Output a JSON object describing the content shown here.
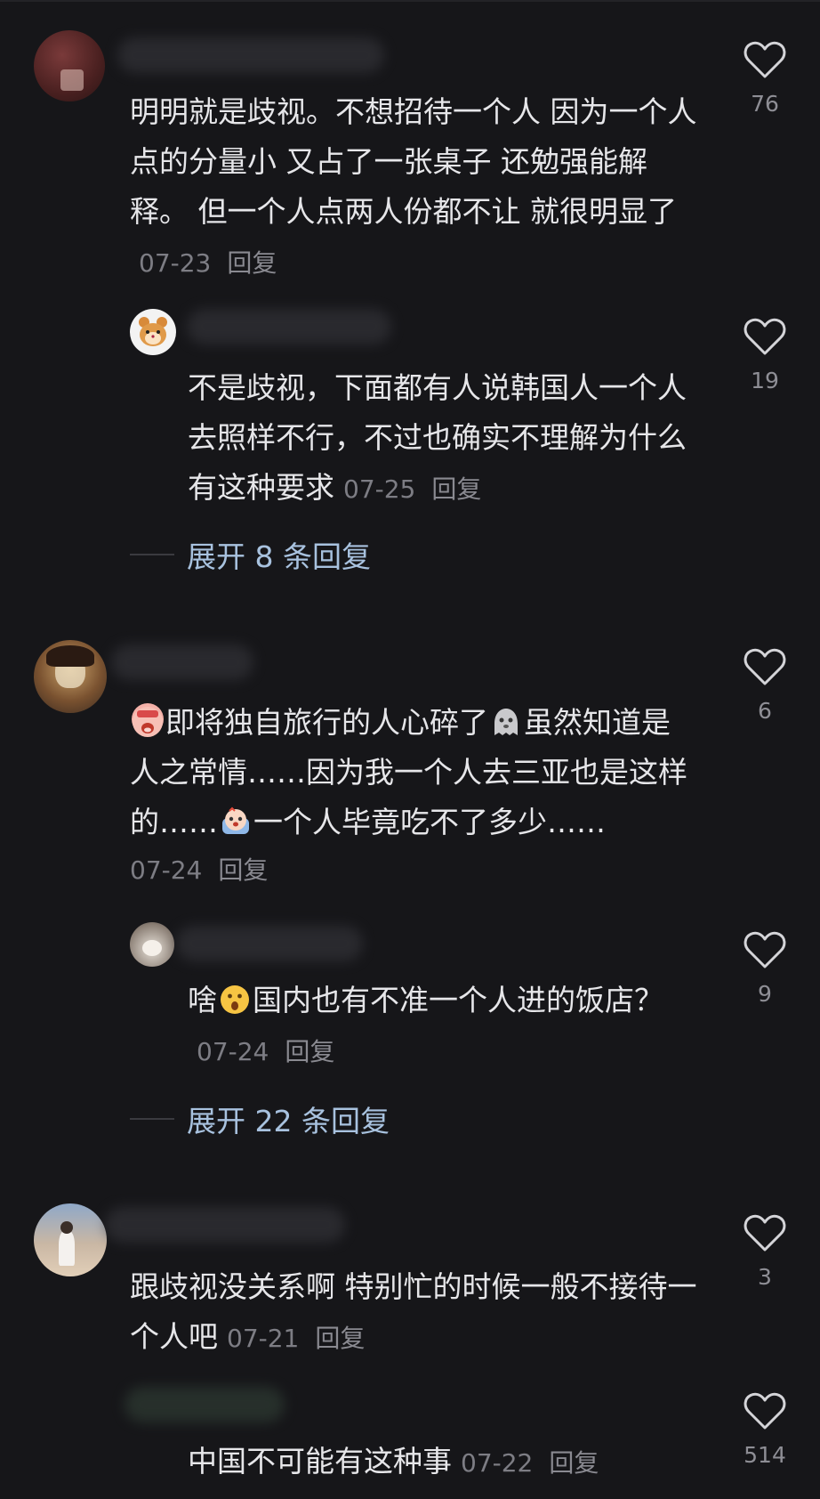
{
  "colors": {
    "background": "#161619",
    "text": "#e6e6e9",
    "meta": "#7d7d84",
    "link": "#a8c2df"
  },
  "comments": [
    {
      "text": "明明就是歧视。不想招待一个人 因为一个人点的分量小 又占了一张桌子 还勉强能解释。 但一个人点两人份都不让 就很明显了",
      "date": "07-23",
      "reply_label": "回复",
      "likes": "76",
      "replies": [
        {
          "avatar_icon": "hamster-avatar-icon",
          "text": "不是歧视，下面都有人说韩国人一个人去照样不行，不过也确实不理解为什么有这种要求",
          "date": "07-25",
          "reply_label": "回复",
          "likes": "19"
        }
      ],
      "expand_label": "展开 8 条回复"
    },
    {
      "text_parts": [
        "即将独自旅行的人心碎了",
        "虽然知道是人之常情……因为我一个人去三亚也是这样的……",
        "一个人毕竟吃不了多少……"
      ],
      "emoji_icons": [
        "crying-face-icon",
        "sad-ghost-icon",
        "scared-face-icon"
      ],
      "date": "07-24",
      "reply_label": "回复",
      "likes": "6",
      "replies": [
        {
          "avatar_icon": "cat-avatar-icon",
          "text_parts": [
            "啥",
            "国内也有不准一个人进的饭店？"
          ],
          "emoji_icons": [
            "surprised-face-icon"
          ],
          "date": "07-24",
          "reply_label": "回复",
          "likes": "9"
        }
      ],
      "expand_label": "展开 22 条回复"
    },
    {
      "text": "跟歧视没关系啊 特别忙的时候一般不接待一个人吧",
      "date": "07-21",
      "reply_label": "回复",
      "likes": "3",
      "replies": [
        {
          "text": "中国不可能有这种事",
          "date": "07-22",
          "reply_label": "回复",
          "likes": "514"
        }
      ]
    }
  ]
}
